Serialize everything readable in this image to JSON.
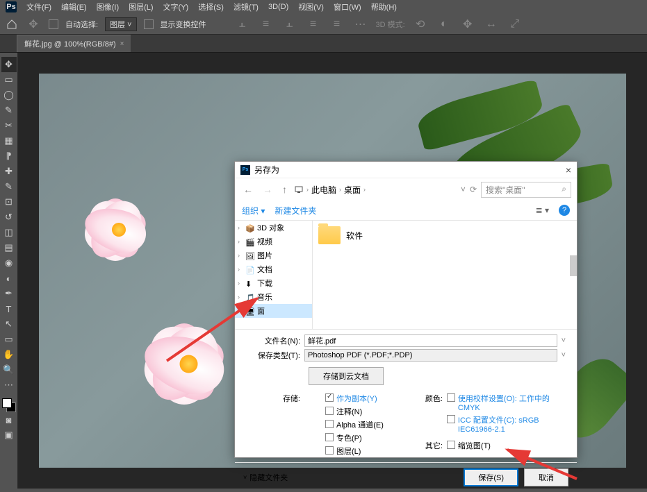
{
  "menu": [
    "文件(F)",
    "编辑(E)",
    "图像(I)",
    "图层(L)",
    "文字(Y)",
    "选择(S)",
    "滤镜(T)",
    "3D(D)",
    "视图(V)",
    "窗口(W)",
    "帮助(H)"
  ],
  "optbar": {
    "auto_select": "自动选择:",
    "layer_sel": "图层",
    "show_transform": "显示变换控件",
    "mode3d": "3D 模式:"
  },
  "tab": {
    "title": "鲜花.jpg @ 100%(RGB/8#)"
  },
  "dialog": {
    "title": "另存为",
    "path": {
      "seg1": "此电脑",
      "seg2": "桌面"
    },
    "search_placeholder": "搜索\"桌面\"",
    "toolbar": {
      "organize": "组织",
      "new_folder": "新建文件夹"
    },
    "tree": [
      {
        "label": "3D 对象",
        "icon": "cube"
      },
      {
        "label": "视频",
        "icon": "video"
      },
      {
        "label": "图片",
        "icon": "picture"
      },
      {
        "label": "文档",
        "icon": "doc"
      },
      {
        "label": "下载",
        "icon": "download"
      },
      {
        "label": "音乐",
        "icon": "music"
      },
      {
        "label": "面",
        "icon": "desktop",
        "selected": true
      }
    ],
    "files": [
      {
        "name": "软件",
        "type": "folder"
      }
    ],
    "filename_label": "文件名(N):",
    "filename_value": "鲜花.pdf",
    "filetype_label": "保存类型(T):",
    "filetype_value": "Photoshop PDF (*.PDF;*.PDP)",
    "cloud_btn": "存储到云文档",
    "store_label": "存储:",
    "store_opts": {
      "as_copy": "作为副本(Y)",
      "notes": "注释(N)",
      "alpha": "Alpha 通道(E)",
      "spot": "专色(P)",
      "layers": "图层(L)"
    },
    "color_label": "颜色:",
    "color_opts": {
      "proof": "使用校样设置(O): 工作中的 CMYK",
      "icc": "ICC 配置文件(C): sRGB IEC61966-2.1"
    },
    "other_label": "其它:",
    "other_opts": {
      "thumb": "缩览图(T)"
    },
    "hide_folders": "隐藏文件夹",
    "save_btn": "保存(S)",
    "cancel_btn": "取消"
  }
}
